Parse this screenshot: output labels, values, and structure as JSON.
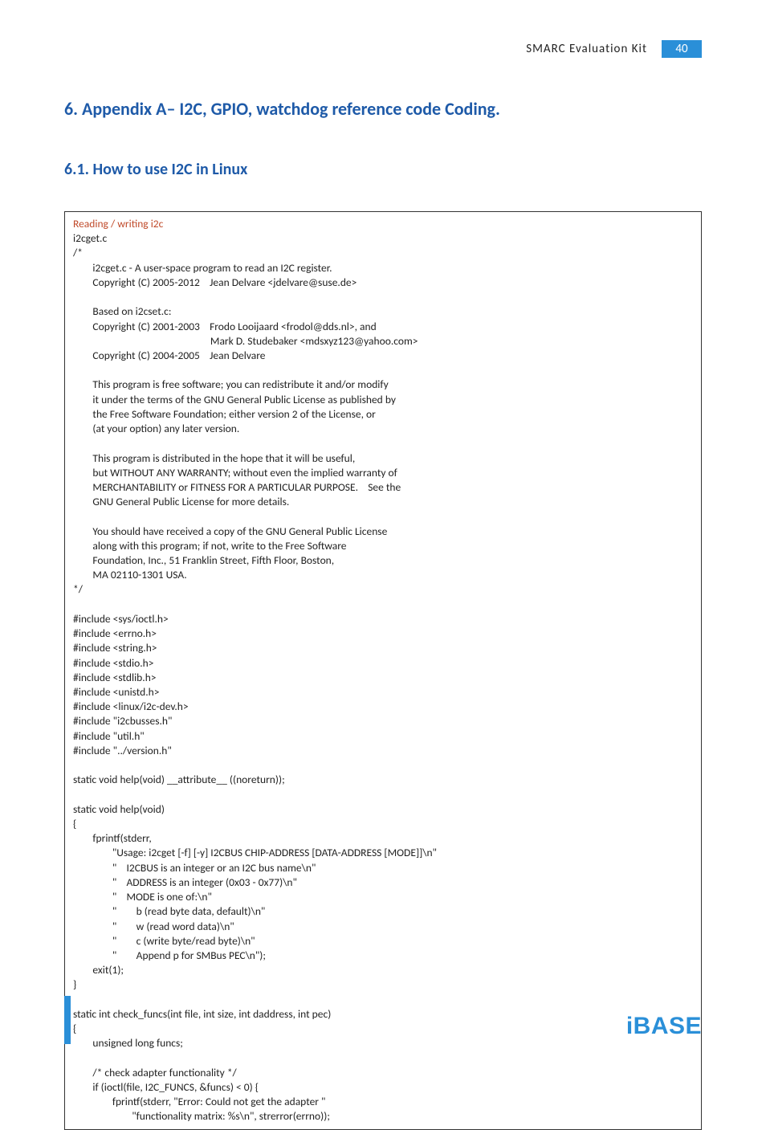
{
  "header": {
    "title": "SMARC  Evaluation  Kit",
    "page_number": "40"
  },
  "heading1": "6.   Appendix A– I2C, GPIO, watchdog reference code Coding.",
  "heading2": "6.1.  How to use I2C in Linux",
  "code": {
    "title": "Reading / writing i2c",
    "body": "i2cget.c\n/*\n        i2cget.c - A user-space program to read an I2C register.\n        Copyright (C) 2005-2012    Jean Delvare <jdelvare@suse.de>\n\n        Based on i2cset.c:\n        Copyright (C) 2001-2003    Frodo Looijaard <frodol@dds.nl>, and\n                                                        Mark D. Studebaker <mdsxyz123@yahoo.com>\n        Copyright (C) 2004-2005    Jean Delvare\n\n        This program is free software; you can redistribute it and/or modify\n        it under the terms of the GNU General Public License as published by\n        the Free Software Foundation; either version 2 of the License, or\n        (at your option) any later version.\n\n        This program is distributed in the hope that it will be useful,\n        but WITHOUT ANY WARRANTY; without even the implied warranty of\n        MERCHANTABILITY or FITNESS FOR A PARTICULAR PURPOSE.    See the\n        GNU General Public License for more details.\n\n        You should have received a copy of the GNU General Public License\n        along with this program; if not, write to the Free Software\n        Foundation, Inc., 51 Franklin Street, Fifth Floor, Boston,\n        MA 02110-1301 USA.\n*/\n\n#include <sys/ioctl.h>\n#include <errno.h>\n#include <string.h>\n#include <stdio.h>\n#include <stdlib.h>\n#include <unistd.h>\n#include <linux/i2c-dev.h>\n#include \"i2cbusses.h\"\n#include \"util.h\"\n#include \"../version.h\"\n\nstatic void help(void) __attribute__ ((noreturn));\n\nstatic void help(void)\n{\n        fprintf(stderr,\n                \"Usage: i2cget [-f] [-y] I2CBUS CHIP-ADDRESS [DATA-ADDRESS [MODE]]\\n\"\n                \"    I2CBUS is an integer or an I2C bus name\\n\"\n                \"    ADDRESS is an integer (0x03 - 0x77)\\n\"\n                \"    MODE is one of:\\n\"\n                \"        b (read byte data, default)\\n\"\n                \"        w (read word data)\\n\"\n                \"        c (write byte/read byte)\\n\"\n                \"        Append p for SMBus PEC\\n\");\n        exit(1);\n}\n\nstatic int check_funcs(int file, int size, int daddress, int pec)\n{\n        unsigned long funcs;\n\n        /* check adapter functionality */\n        if (ioctl(file, I2C_FUNCS, &funcs) < 0) {\n                fprintf(stderr, \"Error: Could not get the adapter \"\n                        \"functionality matrix: %s\\n\", strerror(errno));"
  },
  "logo": "iBASE"
}
